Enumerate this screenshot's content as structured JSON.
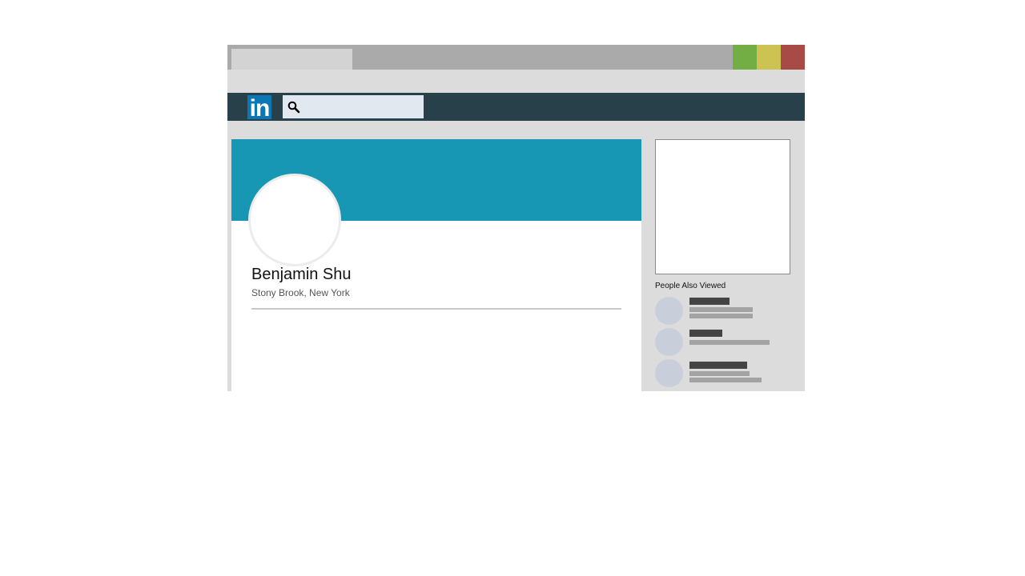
{
  "browser": {
    "tab_title": "",
    "window_buttons": [
      {
        "name": "maximize",
        "color": "#72ae43"
      },
      {
        "name": "minimize",
        "color": "#ccc352"
      },
      {
        "name": "close",
        "color": "#a84b47"
      }
    ]
  },
  "nav": {
    "logo_text": "in",
    "search_icon": "search-icon",
    "search_value": ""
  },
  "profile": {
    "name": "Benjamin Shu",
    "location": "Stony Brook, New York",
    "cover_color": "#1797b4"
  },
  "sidebar": {
    "people_also_viewed_title": "People Also Viewed",
    "people_count_shown": 3
  },
  "colors": {
    "nav_bg": "#27404a",
    "brand": "#0b77b5",
    "page_bg": "#dcdcdc"
  }
}
